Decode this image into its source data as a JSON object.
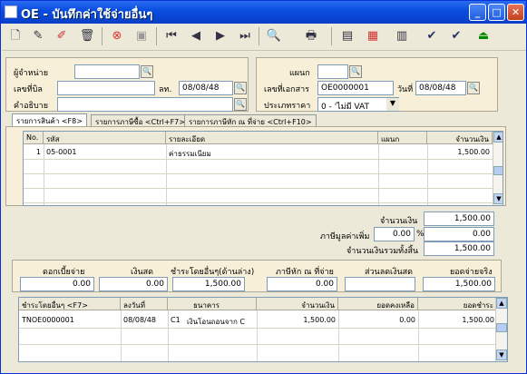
{
  "window": {
    "title": "OE - บันทึกค่าใช้จ่ายอื่นๆ",
    "min": "_",
    "max": "□",
    "close": "✕"
  },
  "toolbar": {
    "icons": [
      "new-icon",
      "edit-icon",
      "pencil-erase-icon",
      "trash-icon",
      "cancel-icon",
      "save-icon",
      "first-icon",
      "prev-icon",
      "next-icon",
      "last-icon",
      "search-icon",
      "print-icon",
      "export-icon",
      "report-icon",
      "calendar-icon",
      "ok-icon",
      "ok2-icon",
      "exit-icon"
    ]
  },
  "header": {
    "vendor_label": "ผู้จำหน่าย",
    "vendor_value": "",
    "bill_label": "เลขที่บิล",
    "bill_value": "",
    "date1_label": "ลท.",
    "date1_value": "08/08/48",
    "desc_label": "คำอธิบาย",
    "desc_value": "",
    "dept_label": "แผนก",
    "dept_value": "",
    "docno_label": "เลขที่เอกสาร",
    "docno_value": "OE0000001",
    "date2_label": "วันที่",
    "date2_value": "08/08/48",
    "taxtype_label": "ประเภทราคา",
    "taxtype_value": "0 - 'ไม่มี VAT"
  },
  "tabs": [
    "รายการสินค้า <F8>",
    "รายการภาษีซื้อ <Ctrl+F7>",
    "รายการภาษีหัก ณ ที่จ่าย <Ctrl+F10>"
  ],
  "items": {
    "columns": [
      "No.",
      "รหัส",
      "รายละเอียด",
      "แผนก",
      "จำนวนเงิน"
    ],
    "rows": [
      [
        "1",
        "05-0001",
        "ค่าธรรมเนียม",
        "",
        "1,500.00"
      ]
    ]
  },
  "summary": {
    "amount_label": "จำนวนเงิน",
    "amount": "1,500.00",
    "vat_label": "ภาษีมูลค่าเพิ่ม",
    "vat_rate": "0.00",
    "pct": "%",
    "vat": "0.00",
    "total_label": "จำนวนเงินรวมทั้งสิ้น",
    "total": "1,500.00"
  },
  "payment": {
    "interest_label": "ดอกเบี้ยจ่าย",
    "interest": "0.00",
    "cash_label": "เงินสด",
    "cash": "0.00",
    "other_label": "ชำระโดยอื่นๆ(ด้านล่าง)",
    "other": "1,500.00",
    "wht_label": "ภาษีหัก ณ ที่จ่าย",
    "wht": "0.00",
    "discount_label": "ส่วนลดเงินสด",
    "discount": "",
    "net_label": "ยอดจ่ายจริง",
    "net": "1,500.00"
  },
  "pay_grid": {
    "columns": [
      "ชำระโดยอื่นๆ <F7>",
      "ลงวันที่",
      "ธนาคาร",
      "จำนวนเงิน",
      "ยอดคงเหลือ",
      "ยอดชำระ"
    ],
    "rows": [
      [
        "TNOE0000001",
        "08/08/48",
        "C1",
        "เงินโอนถอนจาก C",
        "1,500.00",
        "0.00",
        "1,500.00"
      ]
    ]
  }
}
